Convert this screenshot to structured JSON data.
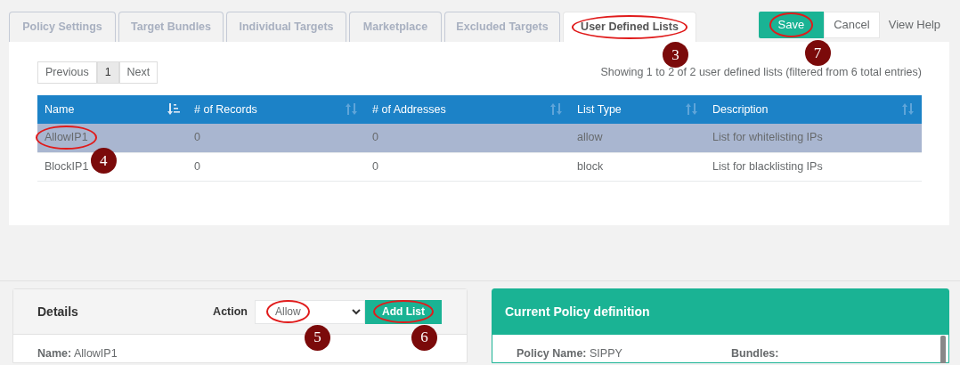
{
  "tabs": [
    {
      "label": "Policy Settings",
      "selected": false
    },
    {
      "label": "Target Bundles",
      "selected": false
    },
    {
      "label": "Individual Targets",
      "selected": false
    },
    {
      "label": "Marketplace",
      "selected": false
    },
    {
      "label": "Excluded Targets",
      "selected": false
    },
    {
      "label": "User Defined Lists",
      "selected": true,
      "callout": "3"
    }
  ],
  "actions": {
    "save": "Save",
    "save_callout": "7",
    "cancel": "Cancel",
    "help": "View Help"
  },
  "pagination": {
    "previous": "Previous",
    "pages": [
      {
        "label": "1",
        "selected": true
      }
    ],
    "next": "Next"
  },
  "info": "Showing 1 to 2 of 2 user defined lists (filtered from 6 total entries)",
  "table": {
    "columns": [
      {
        "label": "Name",
        "sorted": true
      },
      {
        "label": "# of Records",
        "sorted": false
      },
      {
        "label": "# of Addresses",
        "sorted": false
      },
      {
        "label": "List Type",
        "sorted": false
      },
      {
        "label": "Description",
        "sorted": false
      }
    ],
    "rows": [
      {
        "selected": true,
        "name_callout": "4",
        "cells": [
          "AllowIP1",
          "0",
          "0",
          "allow",
          "List for whitelisting IPs"
        ]
      },
      {
        "selected": false,
        "cells": [
          "BlockIP1",
          "0",
          "0",
          "block",
          "List for blacklisting IPs"
        ]
      }
    ]
  },
  "details": {
    "title": "Details",
    "action_label": "Action",
    "action_value": "Allow",
    "action_callout": "5",
    "add_button": "Add List",
    "add_callout": "6",
    "name_label": "Name:",
    "name_value": "AllowIP1"
  },
  "policy": {
    "title": "Current Policy definition",
    "name_label": "Policy Name:",
    "name_value": "SIPPY",
    "bundles_label": "Bundles:"
  }
}
